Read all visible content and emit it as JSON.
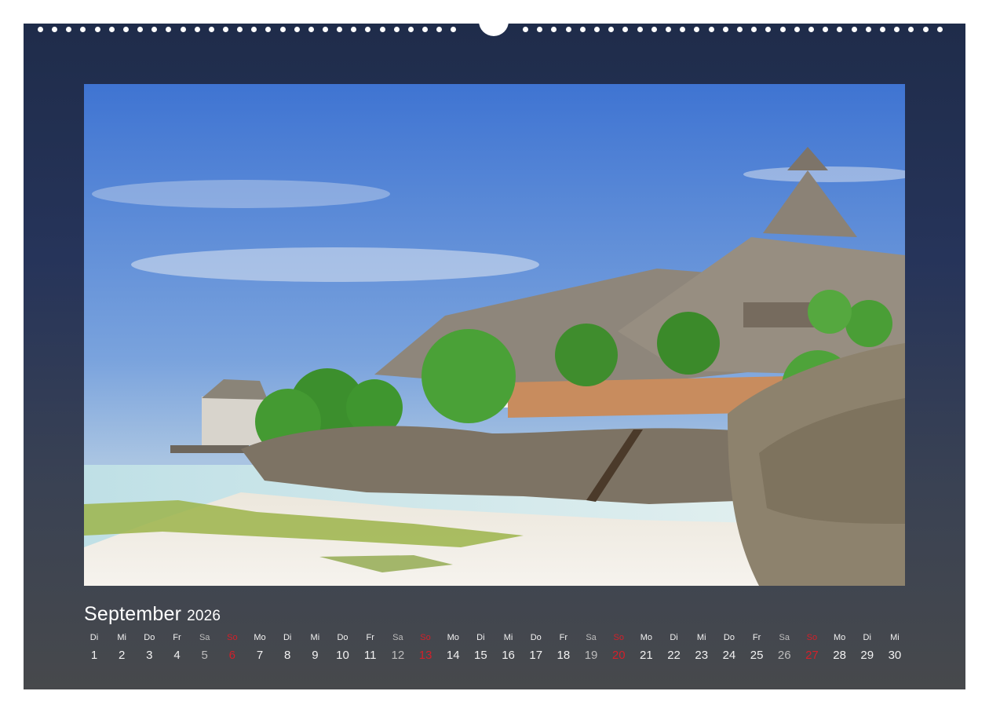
{
  "calendar": {
    "month": "September",
    "year": "2026",
    "weekdays": [
      "Di",
      "Mi",
      "Do",
      "Fr",
      "Sa",
      "So",
      "Mo",
      "Di",
      "Mi",
      "Do",
      "Fr",
      "Sa",
      "So",
      "Mo",
      "Di",
      "Mi",
      "Do",
      "Fr",
      "Sa",
      "So",
      "Mo",
      "Di",
      "Mi",
      "Do",
      "Fr",
      "Sa",
      "So",
      "Mo",
      "Di",
      "Mi"
    ],
    "days": [
      "1",
      "2",
      "3",
      "4",
      "5",
      "6",
      "7",
      "8",
      "9",
      "10",
      "11",
      "12",
      "13",
      "14",
      "15",
      "16",
      "17",
      "18",
      "19",
      "20",
      "21",
      "22",
      "23",
      "24",
      "25",
      "26",
      "27",
      "28",
      "29",
      "30"
    ],
    "sunday_color": "#d2202a",
    "saturday_color": "#bdbdbd"
  },
  "photo": {
    "subject": "thatched-roof beach bungalows on coral rocks by a white sand beach"
  },
  "colors": {
    "background_frame": "#26345a",
    "text": "#ffffff"
  }
}
